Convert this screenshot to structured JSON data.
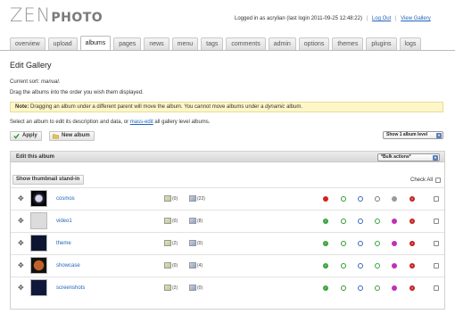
{
  "header": {
    "logo_zen": "ZEN",
    "logo_photo": "PHOTO",
    "login_text": "Logged in as acrylian (last login 2011-09-25 12:48:22)",
    "logout": "Log Out",
    "view_gallery": "View Gallery",
    "sep": "|"
  },
  "tabs": [
    {
      "label": "overview",
      "active": false
    },
    {
      "label": "upload",
      "active": false
    },
    {
      "label": "albums",
      "active": true
    },
    {
      "label": "pages",
      "active": false
    },
    {
      "label": "news",
      "active": false
    },
    {
      "label": "menu",
      "active": false
    },
    {
      "label": "tags",
      "active": false
    },
    {
      "label": "comments",
      "active": false
    },
    {
      "label": "admin",
      "active": false
    },
    {
      "label": "options",
      "active": false
    },
    {
      "label": "themes",
      "active": false
    },
    {
      "label": "plugins",
      "active": false
    },
    {
      "label": "logs",
      "active": false
    }
  ],
  "page": {
    "title": "Edit Gallery",
    "current_sort_label": "Current sort:",
    "current_sort_value": "manual",
    "current_sort_end": ".",
    "drag_hint": "Drag the albums into the order you wish them displayed.",
    "note_label": "Note:",
    "note_text": "Dragging an album under a different parent will move the album. You cannot move albums under a ",
    "note_em": "dynamic",
    "note_end": " album.",
    "select_prefix": "Select an album to edit its description and data, or ",
    "mass_edit_link": "mass-edit",
    "select_suffix": " all gallery level albums."
  },
  "toolbar": {
    "apply_label": "Apply",
    "new_album_label": "New album",
    "show_select": "Show 1 album level"
  },
  "panel": {
    "title": "Edit this album",
    "bulk_actions": "*Bulk actions*",
    "thumb_standin_label": "Show thumbnail stand-in",
    "check_all_label": "Check All"
  },
  "albums": [
    {
      "name": "cosmos",
      "images": "(0)",
      "subalbums": "(22)",
      "thumb": "#101020",
      "statuses": [
        "red",
        "green",
        "blue",
        "graydot",
        "gray",
        "redx"
      ]
    },
    {
      "name": "video1",
      "images": "(0)",
      "subalbums": "(8)",
      "thumb": "#dcdcdc",
      "statuses": [
        "check",
        "green",
        "blue",
        "refresh",
        "purple",
        "redx"
      ]
    },
    {
      "name": "theme",
      "images": "(2)",
      "subalbums": "(0)",
      "thumb": "#0d1530",
      "statuses": [
        "check",
        "green",
        "blue",
        "refresh",
        "purple",
        "redx"
      ]
    },
    {
      "name": "showcase",
      "images": "(0)",
      "subalbums": "(4)",
      "thumb": "#7a3a18",
      "statuses": [
        "check",
        "green",
        "blue",
        "refresh",
        "purple",
        "redx"
      ]
    },
    {
      "name": "screenshots",
      "images": "(2)",
      "subalbums": "(0)",
      "thumb": "#10183a",
      "statuses": [
        "check",
        "green",
        "blue",
        "refresh",
        "purple",
        "redx"
      ]
    }
  ]
}
